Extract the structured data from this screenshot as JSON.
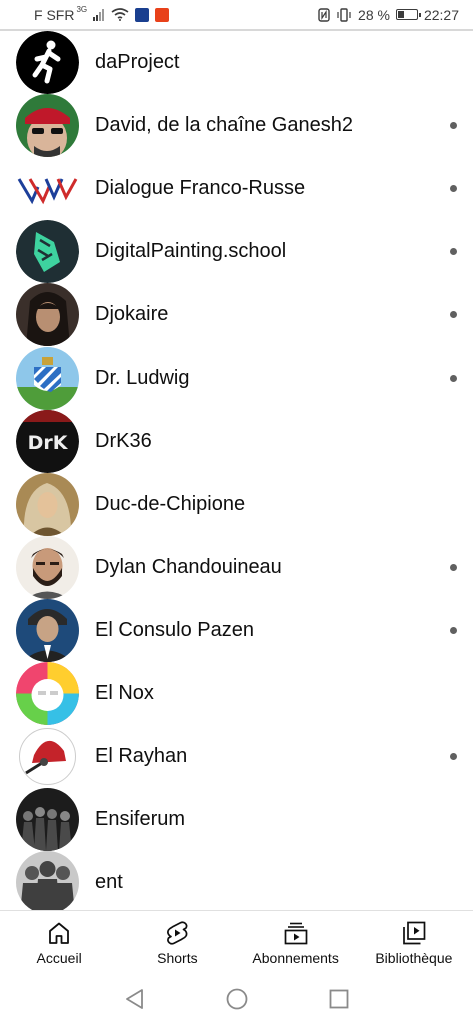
{
  "status_bar": {
    "carrier": "F SFR",
    "network_sup": "3G",
    "battery_text": "28 %",
    "time": "22:27",
    "battery_level": 0.28
  },
  "channels": [
    {
      "name": "daProject",
      "new": false,
      "avatar": "running-man-icon"
    },
    {
      "name": "David, de la chaîne Ganesh2",
      "new": true,
      "avatar": "person-red-cap"
    },
    {
      "name": "Dialogue Franco-Russe",
      "new": true,
      "avatar": "tricolor-v-logo"
    },
    {
      "name": "DigitalPainting.school",
      "new": true,
      "avatar": "green-pen-logo"
    },
    {
      "name": "Djokaire",
      "new": true,
      "avatar": "long-hair-portrait"
    },
    {
      "name": "Dr. Ludwig",
      "new": true,
      "avatar": "bavaria-crest"
    },
    {
      "name": "DrK36",
      "new": false,
      "avatar": "drk-logo"
    },
    {
      "name": "Duc-de-Chipione",
      "new": false,
      "avatar": "baroque-portrait"
    },
    {
      "name": "Dylan Chandouineau",
      "new": true,
      "avatar": "bearded-man-portrait"
    },
    {
      "name": "El Consulo Pazen",
      "new": true,
      "avatar": "suited-man-portrait"
    },
    {
      "name": "El Nox",
      "new": false,
      "avatar": "rainbow-cat-logo"
    },
    {
      "name": "El Rayhan",
      "new": true,
      "avatar": "hat-microphone-logo"
    },
    {
      "name": "Ensiferum",
      "new": false,
      "avatar": "band-photo"
    },
    {
      "name": "ent",
      "new": false,
      "avatar": "silhouettes-photo"
    }
  ],
  "bottom_nav": [
    {
      "label": "Accueil",
      "icon": "home-icon"
    },
    {
      "label": "Shorts",
      "icon": "shorts-icon"
    },
    {
      "label": "Abonnements",
      "icon": "subscriptions-icon"
    },
    {
      "label": "Bibliothèque",
      "icon": "library-icon"
    }
  ],
  "colors": {
    "text": "#0f0f0f",
    "dot": "#606060",
    "accent_red": "#e62117"
  }
}
